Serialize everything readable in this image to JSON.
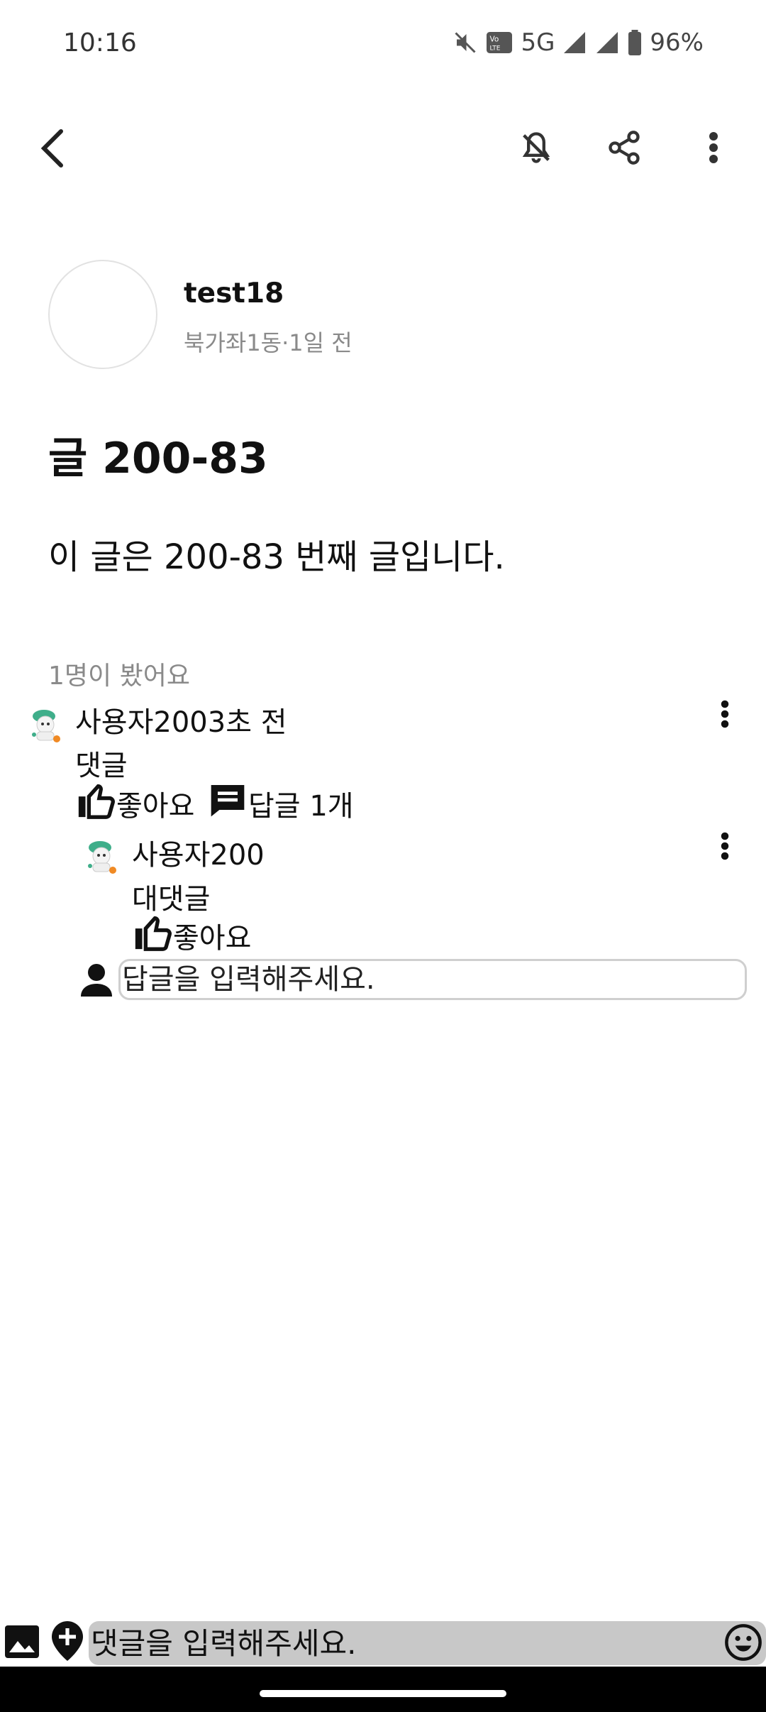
{
  "status_bar": {
    "time": "10:16",
    "network": "5G",
    "volte": "VoLTE",
    "battery": "96%"
  },
  "toolbar": {
    "back_icon": "back-arrow-icon",
    "notifications_off_icon": "bell-off-icon",
    "share_icon": "share-icon",
    "more_icon": "more-vert-icon"
  },
  "post": {
    "author": "test18",
    "meta": "북가좌1동·1일 전",
    "title": "글 200-83",
    "body": "이 글은 200-83 번째 글입니다.",
    "views": "1명이 봤어요"
  },
  "comment": {
    "user_time": "사용자2003초 전",
    "text": "댓글",
    "like_label": "좋아요",
    "reply_label": "답글 1개"
  },
  "reply": {
    "user": "사용자200",
    "text": "대댓글",
    "like_label": "좋아요"
  },
  "reply_input": {
    "placeholder": "답글을 입력해주세요."
  },
  "comment_input": {
    "placeholder": "댓글을 입력해주세요."
  },
  "colors": {
    "accent_text": "#111111",
    "muted_text": "#8a8a8a",
    "input_bg": "#c8c8c8"
  }
}
